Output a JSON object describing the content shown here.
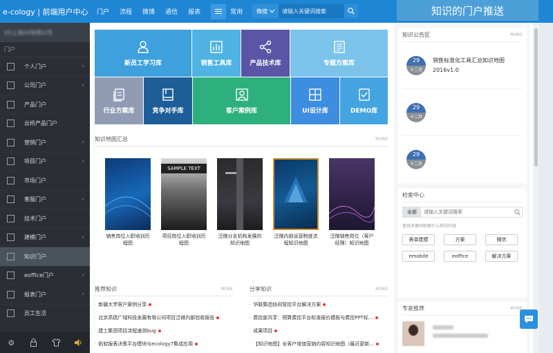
{
  "header": {
    "logo": "e-cology | 前端用户中心",
    "nav": [
      "门户",
      "流程",
      "微博",
      "通信",
      "报表"
    ],
    "nav_extra": "常用",
    "search_type": "微搜",
    "search_placeholder": "请输入关键词搜索",
    "banner": "知识的门户推送"
  },
  "sidebar": {
    "user": "XX上海XX有限公司",
    "title": "门户",
    "items": [
      {
        "label": "个人门户",
        "arrow": "›"
      },
      {
        "label": "公司门户",
        "arrow": "›"
      },
      {
        "label": "产品门户",
        "arrow": ""
      },
      {
        "label": "云桥产品门户",
        "arrow": ""
      },
      {
        "label": "营销门户",
        "arrow": "›"
      },
      {
        "label": "项目门户",
        "arrow": "›"
      },
      {
        "label": "市场门户",
        "arrow": ""
      },
      {
        "label": "客服门户",
        "arrow": "›"
      },
      {
        "label": "技术门户",
        "arrow": ""
      },
      {
        "label": "建模门户",
        "arrow": "›"
      },
      {
        "label": "知识门户",
        "arrow": ""
      },
      {
        "label": "eoffice门户",
        "arrow": "›"
      },
      {
        "label": "报表门户",
        "arrow": "›"
      },
      {
        "label": "员工生活",
        "arrow": ""
      }
    ],
    "active_index": 10
  },
  "tiles": [
    {
      "label": "新员工学习库",
      "icon": "user-icon",
      "color": "#3ea0dc"
    },
    {
      "label": "销售工具库",
      "icon": "chart-icon",
      "color": "#4fb3e3"
    },
    {
      "label": "产品技术库",
      "icon": "share-icon",
      "color": "#5a55a6"
    },
    {
      "label": "专题方案库",
      "icon": "document-icon",
      "color": "#7bc3eb"
    },
    {
      "label": "行业方案库",
      "icon": "file-icon",
      "color": "#8f9cb4"
    },
    {
      "label": "竞争对手库",
      "icon": "book-icon",
      "color": "#1d5e98"
    },
    {
      "label": "客户案例库",
      "icon": "image-icon",
      "color": "#2eb07e"
    },
    {
      "label": "UI设计库",
      "icon": "grid-icon",
      "color": "#3d8de0"
    },
    {
      "label": "DEMO库",
      "icon": "box-icon",
      "color": "#44a4e0"
    }
  ],
  "knowledge_map": {
    "title": "知识地图汇总",
    "more": "MORE",
    "books": [
      {
        "caption": "销售岗位入职培训历程图"
      },
      {
        "caption": "项目岗位入职培训历程图"
      },
      {
        "caption": "泛微分支机构发展的知识地图"
      },
      {
        "caption": "泛微内部运营制度流程知识地图"
      },
      {
        "caption": "泛微销售岗位（客户经理）知识地图"
      }
    ],
    "sample_text": "SAMPLE TEXT"
  },
  "recommend": {
    "title": "推荐知识",
    "more": "MORE",
    "items": [
      "新疆大学客户案例分享",
      "北京高德广域科技发展有限公司项目泛微内部验收报告",
      "建工集团项目流程速测bug",
      "帆软报表决策平台模块与ecology7集成应用"
    ]
  },
  "share": {
    "title": "分享知识",
    "more": "MORE",
    "items": [
      "华联集团协同管控平台解决方案",
      "费控部共享：预算费控平台标准报价模板与费控PPT标...",
      "成果项目",
      "【知识地图】全客户增值营销内容知识地图（最近更新..."
    ]
  },
  "notice": {
    "title": "知识公告区",
    "more": "MORE",
    "items": [
      {
        "day": "29",
        "month": "十二月",
        "text": "销售标准化工具汇总知识地图2016v1.0"
      },
      {
        "day": "29",
        "month": "十二月",
        "text": ""
      },
      {
        "day": "29",
        "month": "十二月",
        "text": ""
      }
    ]
  },
  "search_center": {
    "title": "检索中心",
    "type": "全部",
    "placeholder": "请输入关键词搜索",
    "hint": "查找关键词检索什么样的内容",
    "buttons": [
      "表单建模",
      "方案",
      "微信",
      "emobile",
      "eoffice",
      "解决方案"
    ]
  },
  "experts": {
    "title": "专家推荐",
    "more": "MORE"
  },
  "colors": {
    "topbar": "#1f86d6",
    "sidebar": "#2b2f35",
    "badge": "#3f6fb1"
  }
}
